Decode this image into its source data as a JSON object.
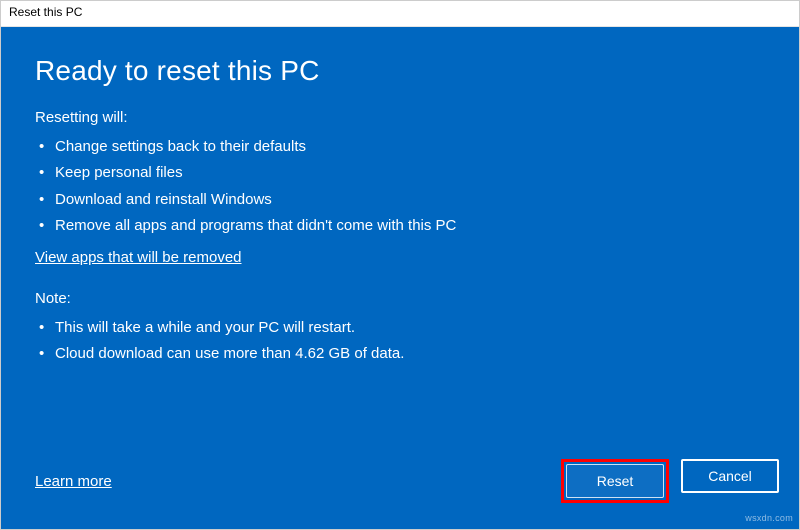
{
  "titlebar": {
    "title": "Reset this PC"
  },
  "main": {
    "heading": "Ready to reset this PC",
    "reset_label": "Resetting will:",
    "reset_bullets": [
      "Change settings back to their defaults",
      "Keep personal files",
      "Download and reinstall Windows",
      "Remove all apps and programs that didn't come with this PC"
    ],
    "view_apps_link": "View apps that will be removed",
    "note_label": "Note:",
    "note_bullets": [
      "This will take a while and your PC will restart.",
      "Cloud download can use more than 4.62 GB of data."
    ]
  },
  "footer": {
    "learn_more": "Learn more",
    "reset_button": "Reset",
    "cancel_button": "Cancel"
  },
  "watermark": "wsxdn.com"
}
